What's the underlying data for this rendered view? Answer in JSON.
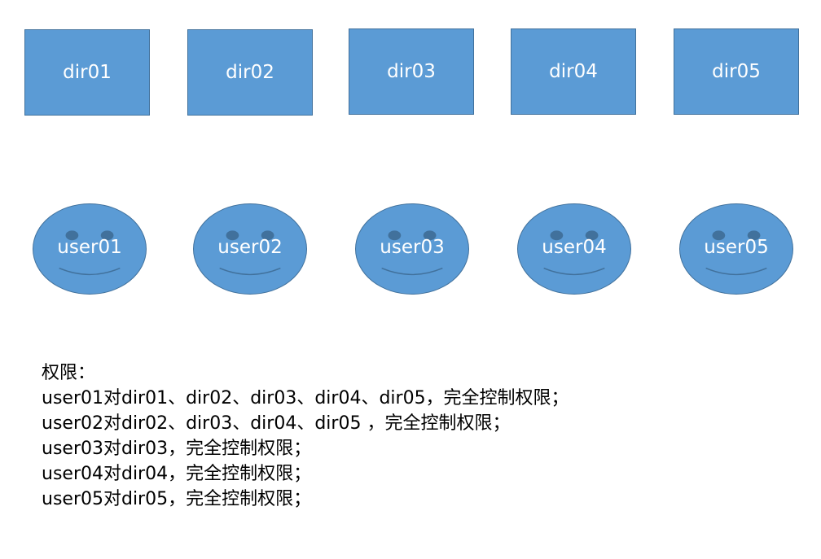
{
  "colors": {
    "fill": "#5b9bd5",
    "stroke": "#41719c",
    "eye": "#41719c",
    "label": "#ffffff",
    "text": "#000000"
  },
  "dirs": [
    {
      "label": "dir01"
    },
    {
      "label": "dir02"
    },
    {
      "label": "dir03"
    },
    {
      "label": "dir04"
    },
    {
      "label": "dir05"
    }
  ],
  "users": [
    {
      "label": "user01"
    },
    {
      "label": "user02"
    },
    {
      "label": "user03"
    },
    {
      "label": "user04"
    },
    {
      "label": "user05"
    }
  ],
  "notes": {
    "title": "权限：",
    "lines": [
      "user01对dir01、dir02、dir03、dir04、dir05，完全控制权限；",
      "user02对dir02、dir03、dir04、dir05 ，完全控制权限；",
      "user03对dir03，完全控制权限；",
      "user04对dir04，完全控制权限；",
      "user05对dir05，完全控制权限；"
    ]
  }
}
